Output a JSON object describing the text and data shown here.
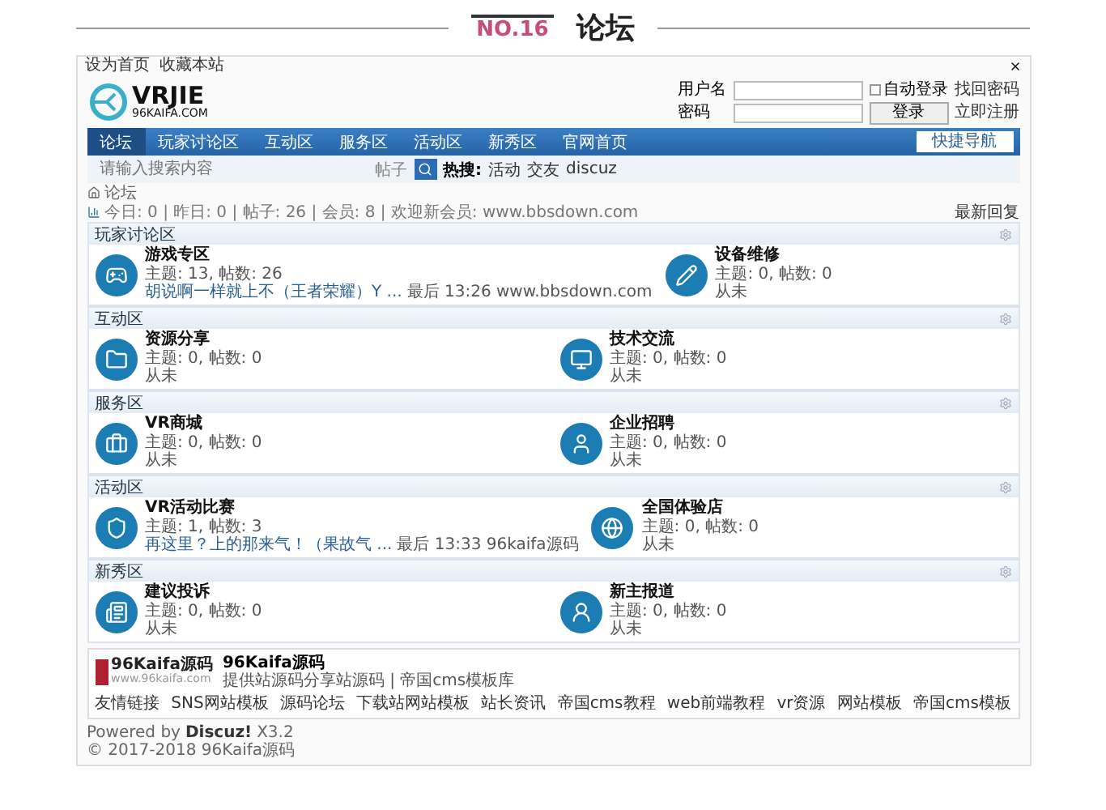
{
  "article_header": {
    "number": "NO.16",
    "title": "论坛"
  },
  "top_bar": {
    "links": [
      "设为首页",
      "收藏本站"
    ]
  },
  "logo": {
    "mark": "VRJIE",
    "domain": "96KAIFA.COM"
  },
  "login": {
    "username_label": "用户名",
    "auto_login": {
      "label": "自动登录",
      "checked": false
    },
    "forgot": "找回密码",
    "password_label": "密码",
    "login_button": "登录",
    "register": "立即注册"
  },
  "nav": {
    "items": [
      {
        "label": "论坛",
        "selected": true
      },
      {
        "label": "玩家讨论区",
        "selected": false
      },
      {
        "label": "互动区",
        "selected": false
      },
      {
        "label": "服务区",
        "selected": false
      },
      {
        "label": "活动区",
        "selected": false
      },
      {
        "label": "新秀区",
        "selected": false
      },
      {
        "label": "官网首页",
        "selected": false
      }
    ],
    "quick_nav": "快捷导航"
  },
  "search": {
    "placeholder": "请输入搜索内容",
    "scope": "帖子",
    "hot_label": "热搜:",
    "hot": [
      "活动",
      "交友",
      "discuz"
    ]
  },
  "breadcrumb": {
    "current": "论坛"
  },
  "stats": {
    "text": "今日: 0 | 昨日: 0 | 帖子: 26 | 会员: 8 | 欢迎新会员: www.bbsdown.com",
    "latest": "最新回复"
  },
  "sections": [
    {
      "title": "玩家讨论区",
      "forums": [
        {
          "name": "游戏专区",
          "stats": "主题: 13, 帖数: 26",
          "last": {
            "kind": "post",
            "link": "胡说啊一样就上不（王者荣耀）Y ...",
            "info": "最后 13:26 www.bbsdown.com"
          }
        },
        {
          "name": "设备维修",
          "stats": "主题: 0, 帖数: 0",
          "last": {
            "kind": "never",
            "info": "从未"
          }
        }
      ]
    },
    {
      "title": "互动区",
      "forums": [
        {
          "name": "资源分享",
          "stats": "主题: 0, 帖数: 0",
          "last": {
            "kind": "never",
            "info": "从未"
          }
        },
        {
          "name": "技术交流",
          "stats": "主题: 0, 帖数: 0",
          "last": {
            "kind": "never",
            "info": "从未"
          }
        }
      ]
    },
    {
      "title": "服务区",
      "forums": [
        {
          "name": "VR商城",
          "stats": "主题: 0, 帖数: 0",
          "last": {
            "kind": "never",
            "info": "从未"
          }
        },
        {
          "name": "企业招聘",
          "stats": "主题: 0, 帖数: 0",
          "last": {
            "kind": "never",
            "info": "从未"
          }
        }
      ]
    },
    {
      "title": "活动区",
      "forums": [
        {
          "name": "VR活动比赛",
          "stats": "主题: 1, 帖数: 3",
          "last": {
            "kind": "post",
            "link": "再这里？上的那来气！（果故气 ...",
            "info": "最后 13:33 96kaifa源码"
          }
        },
        {
          "name": "全国体验店",
          "stats": "主题: 0, 帖数: 0",
          "last": {
            "kind": "never",
            "info": "从未"
          }
        }
      ]
    },
    {
      "title": "新秀区",
      "forums": [
        {
          "name": "建议投诉",
          "stats": "主题: 0, 帖数: 0",
          "last": {
            "kind": "never",
            "info": "从未"
          }
        },
        {
          "name": "新主报道",
          "stats": "主题: 0, 帖数: 0",
          "last": {
            "kind": "never",
            "info": "从未"
          }
        }
      ]
    }
  ],
  "footer": {
    "logo_text": "96Kaifa源码",
    "logo_url": "www.96kaifa.com",
    "site_name": "96Kaifa源码",
    "site_desc": "提供站源码分享站源码 | 帝国cms模板库",
    "links": [
      "友情链接",
      "SNS网站模板",
      "源码论坛",
      "下载站网站模板",
      "站长资讯",
      "帝国cms教程",
      "web前端教程",
      "vr资源",
      "网站模板",
      "帝国cms模板"
    ]
  },
  "powered": {
    "prefix": "Powered by",
    "brand": "Discuz!",
    "version": "X3.2",
    "copyright": "© 2017-2018 96Kaifa源码"
  }
}
